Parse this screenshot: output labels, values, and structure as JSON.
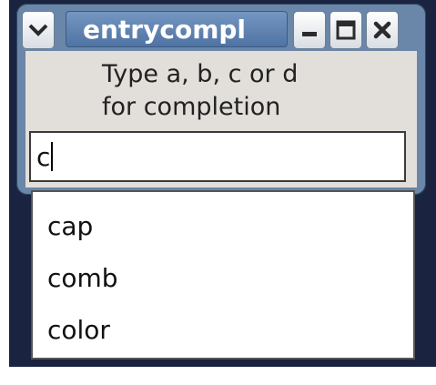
{
  "window": {
    "title": "entrycompl",
    "menu_icon": "chevron-down-icon",
    "minimize_icon": "minimize-icon",
    "maximize_icon": "maximize-icon",
    "close_icon": "close-icon"
  },
  "content": {
    "label": "Type a, b, c or d\nfor completion",
    "entry_value": "c"
  },
  "completion": {
    "items": [
      "cap",
      "comb",
      "color"
    ]
  }
}
